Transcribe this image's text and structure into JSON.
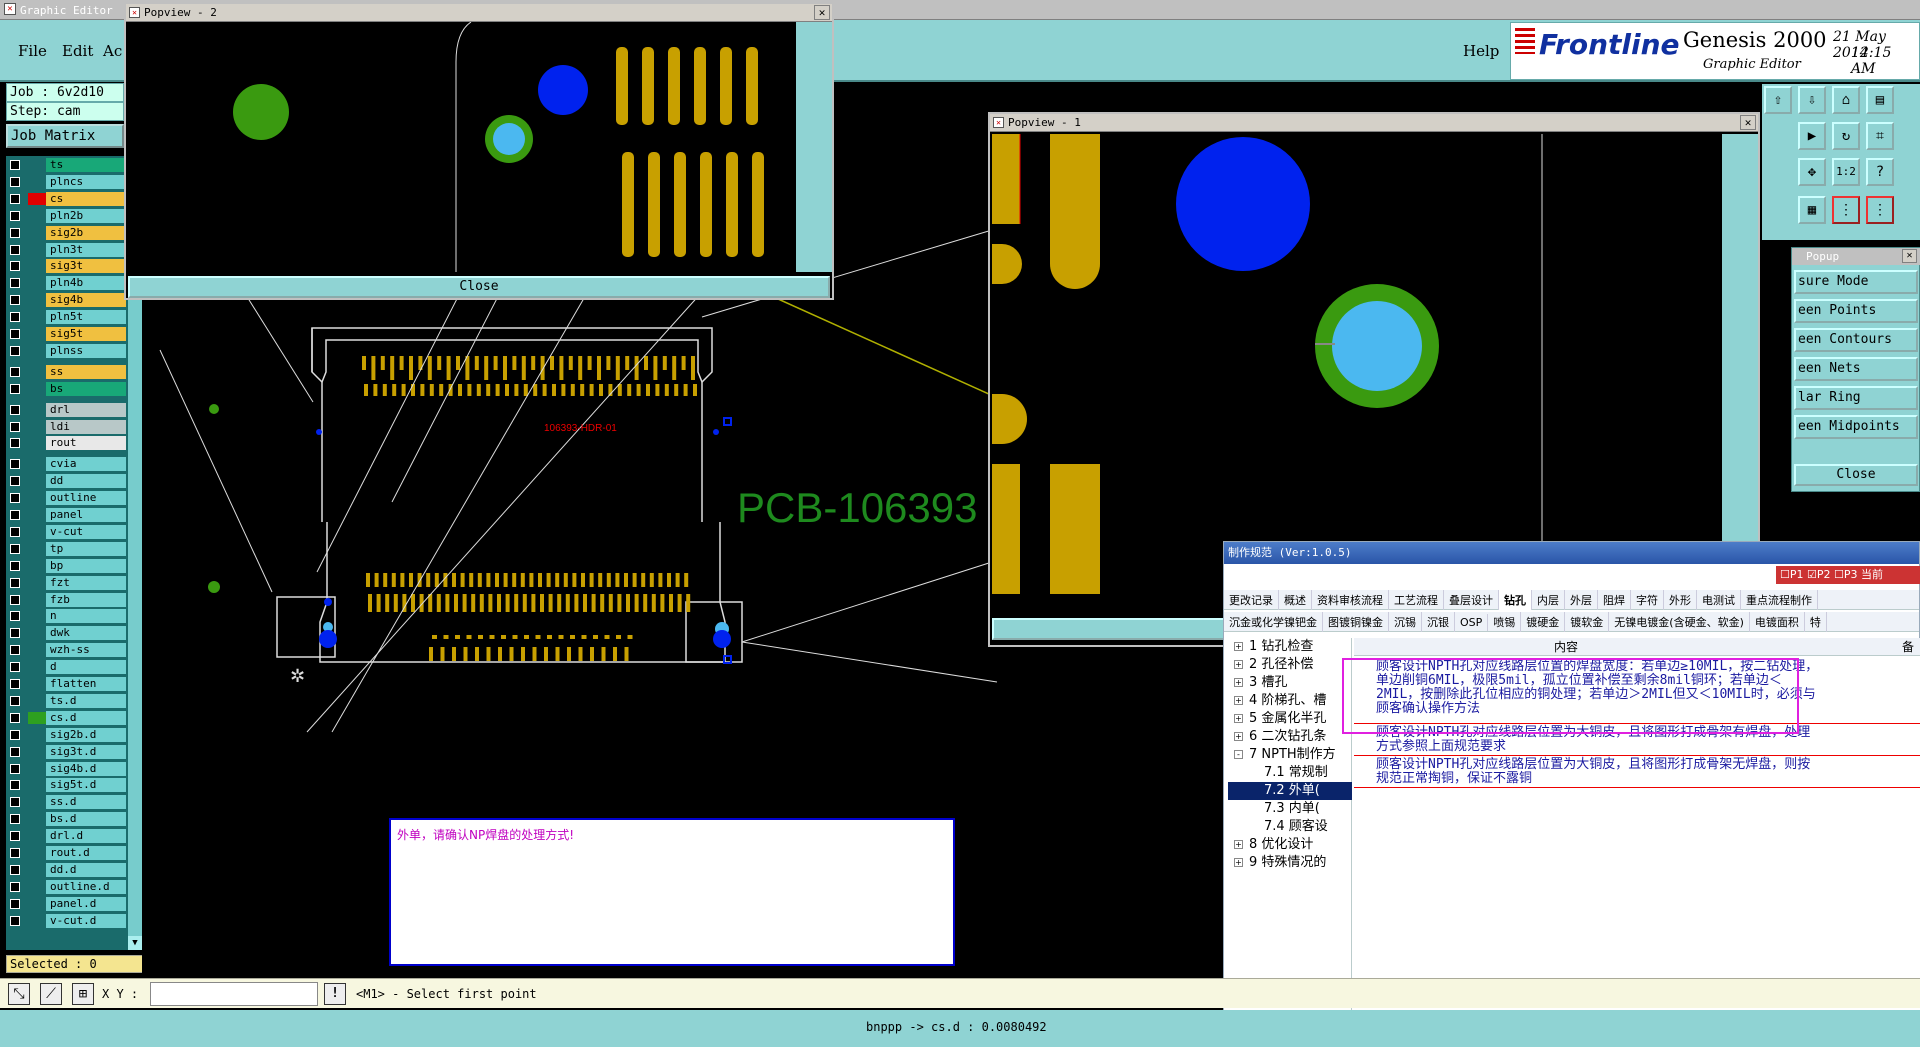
{
  "main_window": {
    "title": "Graphic Editor"
  },
  "menu": {
    "file": "File",
    "edit": "Edit",
    "actions": "Ac",
    "help": "Help"
  },
  "brand": {
    "logo": "Frontline",
    "product": "Genesis 2000",
    "subtitle": "Graphic Editor",
    "date": "21 May 2014",
    "time": "12:15 AM"
  },
  "info": {
    "job": "Job : 6v2d10",
    "step": "Step: cam",
    "job_matrix": "Job Matrix ..."
  },
  "layers": [
    {
      "name": "ts",
      "color": "#18a878"
    },
    {
      "name": "plncs",
      "color": "#70d0d0"
    },
    {
      "name": "cs",
      "color": "#f0c040",
      "sw": "#e00000"
    },
    {
      "name": "pln2b",
      "color": "#70d0d0"
    },
    {
      "name": "sig2b",
      "color": "#f0c040"
    },
    {
      "name": "pln3t",
      "color": "#70d0d0"
    },
    {
      "name": "sig3t",
      "color": "#f0c040"
    },
    {
      "name": "pln4b",
      "color": "#70d0d0"
    },
    {
      "name": "sig4b",
      "color": "#f0c040"
    },
    {
      "name": "pln5t",
      "color": "#70d0d0"
    },
    {
      "name": "sig5t",
      "color": "#f0c040"
    },
    {
      "name": "plnss",
      "color": "#70d0d0"
    },
    {
      "name": "ss",
      "color": "#f0c040"
    },
    {
      "name": "bs",
      "color": "#18a878"
    },
    {
      "name": "drl",
      "color": "#b8c8c8"
    },
    {
      "name": "ldi",
      "color": "#b8c8c8"
    },
    {
      "name": "rout",
      "color": "#e8e8e8"
    },
    {
      "name": "cvia",
      "color": "#70d0d0"
    },
    {
      "name": "dd",
      "color": "#70d0d0"
    },
    {
      "name": "outline",
      "color": "#70d0d0"
    },
    {
      "name": "panel",
      "color": "#70d0d0"
    },
    {
      "name": "v-cut",
      "color": "#70d0d0"
    },
    {
      "name": "tp",
      "color": "#70d0d0"
    },
    {
      "name": "bp",
      "color": "#70d0d0"
    },
    {
      "name": "fzt",
      "color": "#70d0d0"
    },
    {
      "name": "fzb",
      "color": "#70d0d0"
    },
    {
      "name": "n",
      "color": "#70d0d0"
    },
    {
      "name": "dwk",
      "color": "#70d0d0"
    },
    {
      "name": "wzh-ss",
      "color": "#70d0d0"
    },
    {
      "name": "d",
      "color": "#70d0d0"
    },
    {
      "name": "flatten",
      "color": "#70d0d0"
    },
    {
      "name": "ts.d",
      "color": "#70d0d0"
    },
    {
      "name": "cs.d",
      "color": "#70d0d0",
      "sw": "#2ea020"
    },
    {
      "name": "sig2b.d",
      "color": "#70d0d0"
    },
    {
      "name": "sig3t.d",
      "color": "#70d0d0"
    },
    {
      "name": "sig4b.d",
      "color": "#70d0d0"
    },
    {
      "name": "sig5t.d",
      "color": "#70d0d0"
    },
    {
      "name": "ss.d",
      "color": "#70d0d0"
    },
    {
      "name": "bs.d",
      "color": "#70d0d0"
    },
    {
      "name": "drl.d",
      "color": "#70d0d0"
    },
    {
      "name": "rout.d",
      "color": "#70d0d0"
    },
    {
      "name": "dd.d",
      "color": "#70d0d0"
    },
    {
      "name": "outline.d",
      "color": "#70d0d0"
    },
    {
      "name": "panel.d",
      "color": "#70d0d0"
    },
    {
      "name": "v-cut.d",
      "color": "#70d0d0"
    }
  ],
  "selected": "Selected : 0",
  "bottom": {
    "xy_label": "X Y :",
    "xy_value": "",
    "prompt": "<M1> - Select first point"
  },
  "status": "bnppp -> cs.d : 0.0080492",
  "canvas": {
    "board_label": "106393-HDR-01",
    "big_label": "PCB-106393",
    "message": "外单，请确认NP焊盘的处理方式!"
  },
  "popview2": {
    "title": "Popview - 2",
    "close": "Close"
  },
  "popview1": {
    "title": "Popview - 1",
    "close": "Close"
  },
  "measure_popup": {
    "title": "Popup",
    "items": [
      "sure Mode",
      "een Points",
      "een Contours",
      "een Nets",
      "lar Ring",
      "een Midpoints"
    ],
    "close": "Close"
  },
  "rule_panel": {
    "title": "制作规范 (Ver:1.0.5)",
    "top_right": [
      "P1",
      "P2",
      "P3",
      "当前"
    ],
    "tabs_row1": [
      "更改记录",
      "概述",
      "资料审核流程",
      "工艺流程",
      "叠层设计",
      "钻孔",
      "内层",
      "外层",
      "阻焊",
      "字符",
      "外形",
      "电测试",
      "重点流程制作"
    ],
    "tabs_row2": [
      "沉金或化学镍钯金",
      "图镀铜镍金",
      "沉锡",
      "沉银",
      "OSP",
      "喷锡",
      "镀硬金",
      "镀软金",
      "无镍电镀金(含硬金、软金)",
      "电镀面积",
      "特"
    ],
    "active_tab": "钻孔",
    "tree": [
      {
        "label": "1 钻孔检查",
        "exp": "+"
      },
      {
        "label": "2 孔径补偿",
        "exp": "+"
      },
      {
        "label": "3 槽孔",
        "exp": "+"
      },
      {
        "label": "4 阶梯孔、槽",
        "exp": "+"
      },
      {
        "label": "5 金属化半孔",
        "exp": "+"
      },
      {
        "label": "6 二次钻孔条",
        "exp": "+"
      },
      {
        "label": "7 NPTH制作方",
        "exp": "-"
      },
      {
        "label": "7.1 常规制",
        "exp": ""
      },
      {
        "label": "7.2 外单(",
        "exp": "",
        "selected": true
      },
      {
        "label": "7.3 内单(",
        "exp": ""
      },
      {
        "label": "7.4 顾客设",
        "exp": ""
      },
      {
        "label": "8 优化设计",
        "exp": "+"
      },
      {
        "label": "9 特殊情况的",
        "exp": "+"
      }
    ],
    "col_content": "内容",
    "col_note": "备",
    "rows": [
      "顾客设计NPTH孔对应线路层位置的焊盘宽度：若单边≥10MIL，按二钻处理，单边削铜6MIL，极限5mil，孤立位置补偿至剩余8mil铜环；若单边＜2MIL，按删除此孔位相应的铜处理；若单边＞2MIL但又＜10MIL时，必须与顾客确认操作方法",
      "顾客设计NPTH孔对应线路层位置为大铜皮，且将图形打成骨架有焊盘，处理方式参照上面规范要求",
      "顾客设计NPTH孔对应线路层位置为大铜皮，且将图形打成骨架无焊盘，则按规范正常掏铜，保证不露铜"
    ]
  },
  "colors": {
    "teal": "#8fd3d3",
    "gold": "#c8a000",
    "pad_blue": "#0022ee",
    "pad_green": "#3a9a10",
    "via_light": "#4bb8f0"
  }
}
